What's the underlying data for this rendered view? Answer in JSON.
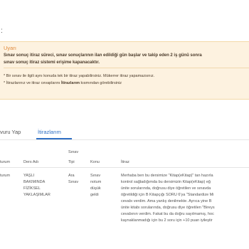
{
  "page": {
    "fragment": ":"
  },
  "alert": {
    "title": "Uyarı",
    "lines": [
      "Sınav sonuç itiraz süreci, sınav sonuçlarının ilan edildiği gün başlar ve takip eden 2 iş günü sonra",
      "sınav sonuç itiraz sistemi erişime kapanacaktır."
    ],
    "bullet1": "* Bir sınav ile ilgili aynı konuda tek bir itiraz yapabilirsiniz. Mükerrer itiraz yapamazsınız.",
    "bullet2_pre": "* İtirazlarınız ve itiraz cevaplarını ",
    "bullet2_bold": "İtirazlarım",
    "bullet2_post": " kısmından görebilirsiniz"
  },
  "tabs": [
    {
      "label": "vuru Yap"
    },
    {
      "label": "İtirazlarım"
    }
  ],
  "table": {
    "headers": {
      "col1": "turum",
      "ders": "Ders Adı",
      "tipi": [
        "Sınav",
        "Tipi"
      ],
      "konu": "Konu",
      "itiraz": "İtiraz"
    },
    "row": {
      "col1": "turum",
      "ders": [
        "YAŞLI",
        "BAKIMINDA",
        "FİZİKSEL",
        "YAKLAŞIMLAR"
      ],
      "tipi": [
        "Ara",
        "Sınav"
      ],
      "konu": [
        "Sınav",
        "notum",
        "düşük",
        "geldi"
      ],
      "itiraz": [
        "Merhaba ben bu dersimize \"Kitap(eKitap)\" tan hazırla",
        "kontrol sağladığımda bu dersimizin Kitap(eKitap) eğ",
        "ünite sorularında, doğrusu diye öğretilen ve sınavda",
        "öğretildiği için B Kitapçığı SORU 6'ya \"Standardize Mi",
        "cevabı verdim. Ama yanlış denilmekte. Ayrıca yine B",
        "ünite kitabı sorularında, doğrusu diye öğretilen \"Bireys",
        "cevabının verdim. Fakat bu da doğru sayılmamış, hoc",
        "kaynaklanmadığı için bu 2 soru için +10 puan iyileştir"
      ]
    }
  }
}
